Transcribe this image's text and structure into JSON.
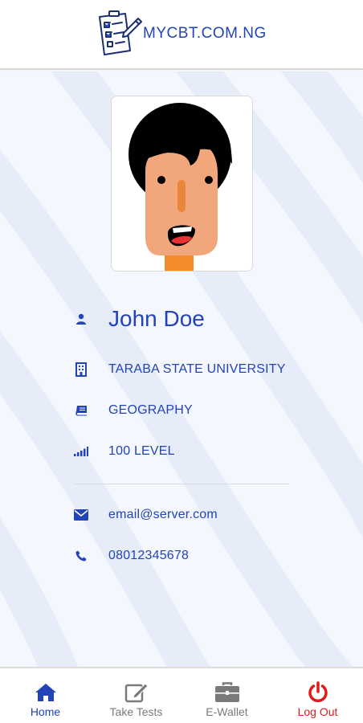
{
  "header": {
    "brand": "MYCBT.COM.NG"
  },
  "profile": {
    "name": "John Doe",
    "institution": "TARABA STATE UNIVERSITY",
    "department": "GEOGRAPHY",
    "level": "100 LEVEL",
    "email": "email@server.com",
    "phone": "08012345678"
  },
  "nav": {
    "home": "Home",
    "take_tests": "Take Tests",
    "wallet": "E-Wallet",
    "logout": "Log Out"
  },
  "colors": {
    "accent": "#2343b8",
    "nav_inactive": "#7a7a7a",
    "logout": "#e01b1b",
    "background_stripe": "#e8eef9"
  },
  "icons": {
    "header": "checklist-logo-icon",
    "name": "user-icon",
    "institution": "building-icon",
    "department": "book-icon",
    "level": "signal-bars-icon",
    "email": "envelope-icon",
    "phone": "phone-icon",
    "home": "home-icon",
    "take_tests": "edit-icon",
    "wallet": "briefcase-icon",
    "logout": "power-icon"
  }
}
